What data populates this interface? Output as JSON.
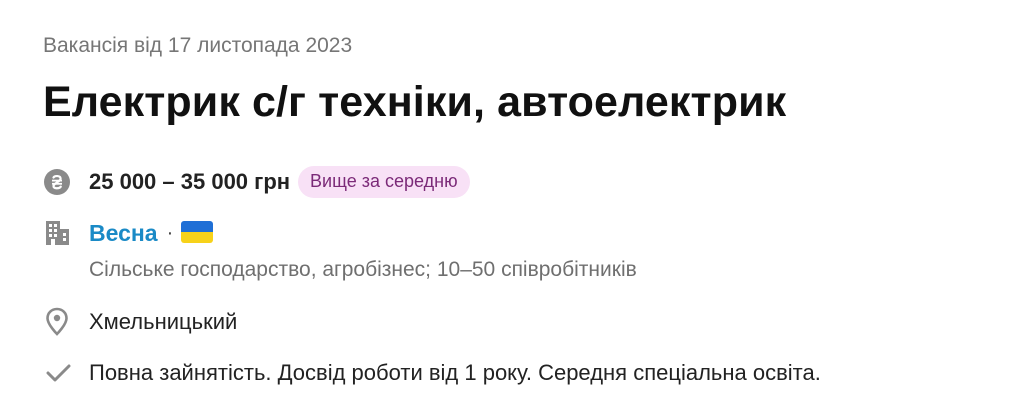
{
  "vacancy": {
    "posted": "Вакансія від 17 листопада 2023",
    "title": "Електрик с/г техніки, автоелектрик",
    "salary": {
      "icon": "hryvnia-coin-icon",
      "amount": "25 000 – 35 000 грн",
      "badge": "Вище за середню"
    },
    "company": {
      "icon": "office-building-icon",
      "name": "Весна",
      "separator": "·",
      "flag_icon": "ukraine-flag-icon",
      "description": "Сільське господарство, агробізнес; 10–50 співробітників"
    },
    "location": {
      "icon": "location-pin-icon",
      "city": "Хмельницький"
    },
    "conditions": {
      "icon": "checkmark-icon",
      "text": "Повна зайнятість. Досвід роботи від 1 року. Середня спеціальна освіта."
    }
  },
  "colors": {
    "accent_link": "#1a8ac6",
    "badge_bg": "#f8e1f6",
    "badge_text": "#7b2a78",
    "muted_text": "#767676",
    "icon_gray": "#8a8a8a",
    "flag_blue": "#1f6fd6",
    "flag_yellow": "#f7d21a"
  }
}
